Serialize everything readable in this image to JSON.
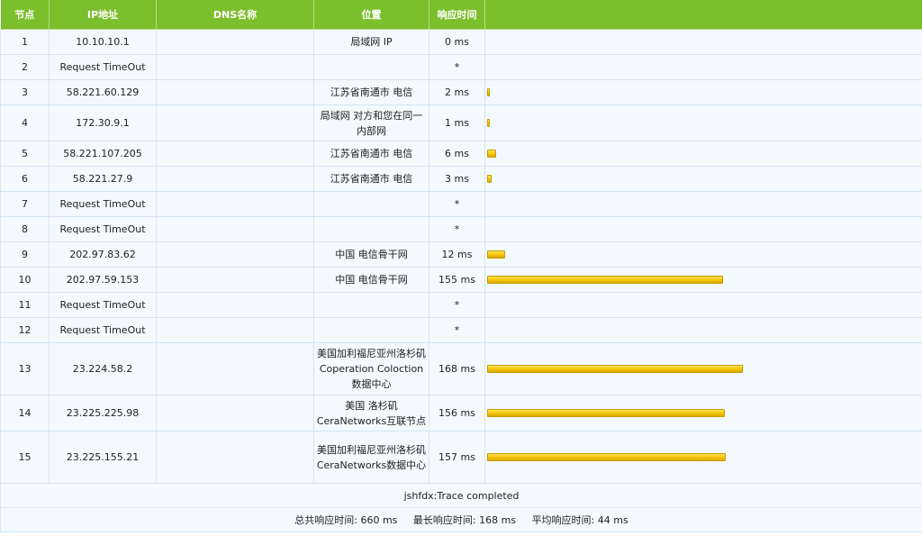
{
  "headers": {
    "node": "节点",
    "ip": "IP地址",
    "dns": "DNS名称",
    "location": "位置",
    "time": "响应时间",
    "bar": ""
  },
  "rows": [
    {
      "node": "1",
      "ip": "10.10.10.1",
      "dns": "",
      "location": "局域网 IP",
      "time": "0 ms",
      "ms": 0
    },
    {
      "node": "2",
      "ip": "Request TimeOut",
      "dns": "",
      "location": "",
      "time": "*",
      "ms": null
    },
    {
      "node": "3",
      "ip": "58.221.60.129",
      "dns": "",
      "location": "江苏省南通市 电信",
      "time": "2 ms",
      "ms": 2
    },
    {
      "node": "4",
      "ip": "172.30.9.1",
      "dns": "",
      "location": "局域网 对方和您在同一内部网",
      "time": "1 ms",
      "ms": 1
    },
    {
      "node": "5",
      "ip": "58.221.107.205",
      "dns": "",
      "location": "江苏省南通市 电信",
      "time": "6 ms",
      "ms": 6
    },
    {
      "node": "6",
      "ip": "58.221.27.9",
      "dns": "",
      "location": "江苏省南通市 电信",
      "time": "3 ms",
      "ms": 3
    },
    {
      "node": "7",
      "ip": "Request TimeOut",
      "dns": "",
      "location": "",
      "time": "*",
      "ms": null
    },
    {
      "node": "8",
      "ip": "Request TimeOut",
      "dns": "",
      "location": "",
      "time": "*",
      "ms": null
    },
    {
      "node": "9",
      "ip": "202.97.83.62",
      "dns": "",
      "location": "中国 电信骨干网",
      "time": "12 ms",
      "ms": 12
    },
    {
      "node": "10",
      "ip": "202.97.59.153",
      "dns": "",
      "location": "中国 电信骨干网",
      "time": "155 ms",
      "ms": 155
    },
    {
      "node": "11",
      "ip": "Request TimeOut",
      "dns": "",
      "location": "",
      "time": "*",
      "ms": null
    },
    {
      "node": "12",
      "ip": "Request TimeOut",
      "dns": "",
      "location": "",
      "time": "*",
      "ms": null
    },
    {
      "node": "13",
      "ip": "23.224.58.2",
      "dns": "",
      "location": "美国加利福尼亚州洛杉矶 Coperation Coloction数据中心",
      "time": "168 ms",
      "ms": 168
    },
    {
      "node": "14",
      "ip": "23.225.225.98",
      "dns": "",
      "location": "美国 洛杉矶CeraNetworks互联节点",
      "time": "156 ms",
      "ms": 156
    },
    {
      "node": "15",
      "ip": "23.225.155.21",
      "dns": "",
      "location": "美国加利福尼亚州洛杉矶 CeraNetworks数据中心",
      "time": "157 ms",
      "ms": 157
    }
  ],
  "status": "jshfdx:Trace completed",
  "summary": {
    "total_label": "总共响应时间:",
    "total_value": "660 ms",
    "max_label": "最长响应时间:",
    "max_value": "168 ms",
    "avg_label": "平均响应时间:",
    "avg_value": "44 ms"
  },
  "colors": {
    "header_bg": "#7cbf2c",
    "row_bg": "#f3f9fd",
    "bar": "#f5c400"
  }
}
